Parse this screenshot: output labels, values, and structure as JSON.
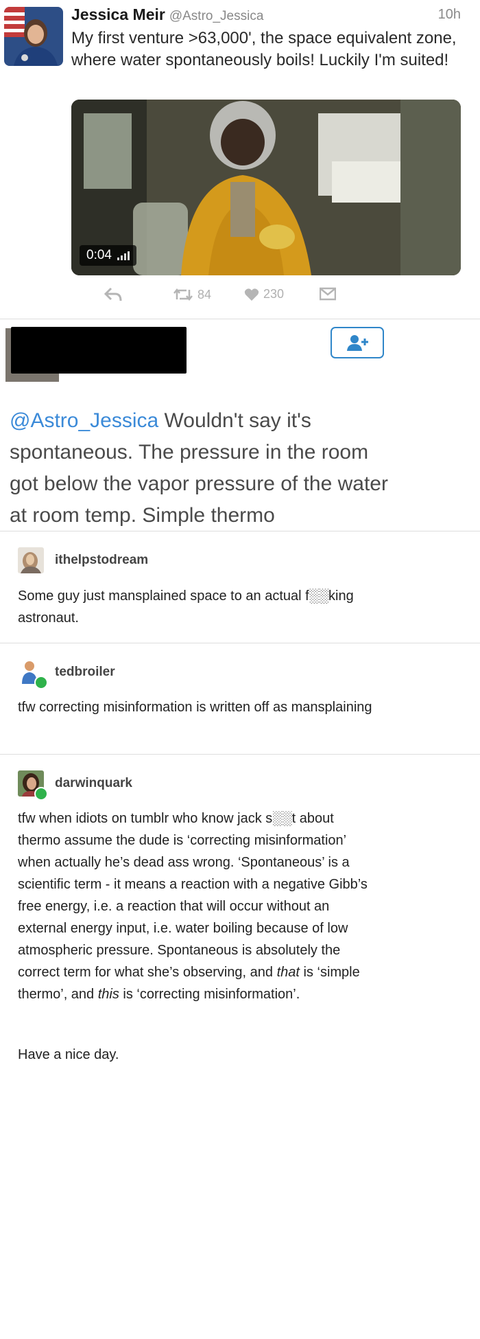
{
  "tweet": {
    "author_name": "Jessica Meir",
    "author_handle": "@Astro_Jessica",
    "time": "10h",
    "text": "My first venture >63,000', the space equivalent zone, where water spontaneously boils! Luckily I'm suited!",
    "video_duration": "0:04",
    "retweet_count": "84",
    "like_count": "230"
  },
  "reply": {
    "mention": "@Astro_Jessica",
    "text": " Wouldn't say it's spontaneous. The pressure in the room got below the vapor pressure of the water at room temp. Simple thermo"
  },
  "comments": [
    {
      "username": "ithelpstodream",
      "body": "Some guy just mansplained space to an actual f░░king astronaut."
    },
    {
      "username": "tedbroiler",
      "body": "tfw correcting misinformation is written off as mansplaining"
    },
    {
      "username": "darwinquark",
      "body_part1": "tfw when idiots on tumblr who know jack s░░t about thermo assume the dude is ‘correcting misinformation’ when actually he’s dead ass wrong. ‘Spontaneous’ is a scientific term - it means a reaction with a negative Gibb’s free energy, i.e. a reaction that will occur without an external energy input, i.e. water boiling because of low atmospheric pressure. Spontaneous is absolutely the correct term for what she’s observing, and ",
      "em1": "that",
      "body_part2": " is ‘simple thermo’, and ",
      "em2": "this",
      "body_part3": " is ‘correcting misinformation’.",
      "closing": "Have a nice day."
    }
  ],
  "colors": {
    "mention": "#3b8ad8",
    "follow_button": "#2f86c9",
    "badge_green": "#2fb24b"
  }
}
